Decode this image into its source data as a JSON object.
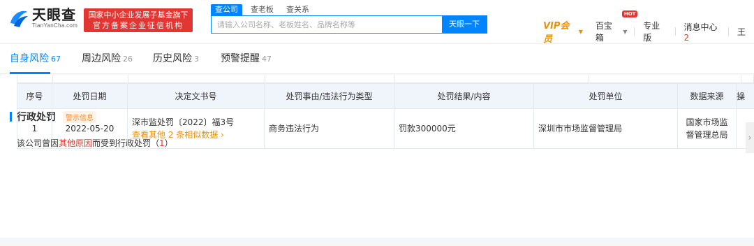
{
  "header": {
    "logo_main": "天眼查",
    "logo_sub": "TianYanCha.com",
    "gov_badge_line1": "国家中小企业发展子基金旗下",
    "gov_badge_line2": "官方备案企业征信机构",
    "search_tabs": [
      "查公司",
      "查老板",
      "查关系"
    ],
    "search_placeholder": "请输入公司名称、老板姓名、品牌名称等",
    "search_button": "天眼一下",
    "vip_label": "VIP会员",
    "baobaoxiang_label": "百宝箱",
    "hot_badge": "HOT",
    "pro_label": "专业版",
    "message_label": "消息中心",
    "message_count": "2",
    "user_label": "王"
  },
  "risk_tabs": [
    {
      "label": "自身风险",
      "count": "67"
    },
    {
      "label": "周边风险",
      "count": "26"
    },
    {
      "label": "历史风险",
      "count": "3"
    },
    {
      "label": "预警提醒",
      "count": "47"
    }
  ],
  "section": {
    "title": "行政处罚",
    "tag": "警示信息",
    "summary_prefix": "该公司曾因",
    "summary_reason": "其他原因",
    "summary_middle": "而受到行政处罚（",
    "summary_count": "1",
    "summary_suffix": "）"
  },
  "table": {
    "columns": [
      "序号",
      "处罚日期",
      "决定文书号",
      "处罚事由/违法行为类型",
      "处罚结果/内容",
      "处罚单位",
      "数据来源",
      "操"
    ],
    "rows": [
      {
        "index": "1",
        "date": "2022-05-20",
        "doc_no": "深市监处罚〔2022〕福3号",
        "doc_link": "查看其他 2 条相似数据 ›",
        "reason": "商务违法行为",
        "result": "罚款300000元",
        "unit": "深圳市市场监督管理局",
        "source": "国家市场监督管理总局"
      }
    ]
  },
  "scroll_arrow": "›"
}
